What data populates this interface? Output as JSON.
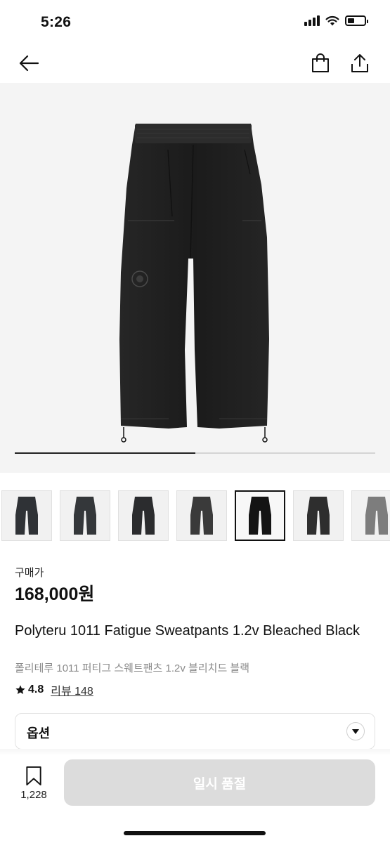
{
  "status_bar": {
    "time": "5:26"
  },
  "nav": {
    "back_icon": "arrow-left-icon",
    "bag_icon": "shopping-bag-icon",
    "share_icon": "share-icon"
  },
  "gallery": {
    "progress_fraction": 0.5,
    "thumbnail_count": 7,
    "selected_index": 4
  },
  "product": {
    "price_label": "구매가",
    "price": "168,000원",
    "title_en": "Polyteru 1011 Fatigue Sweatpants 1.2v Bleached Black",
    "title_ko": "폴리테루 1011 퍼티그 스웨트팬츠 1.2v 블리치드 블랙",
    "rating": "4.8",
    "review_text": "리뷰 148"
  },
  "option": {
    "label": "옵션"
  },
  "bottom_bar": {
    "bookmark_count": "1,228",
    "buy_label": "일시 품절",
    "buy_disabled": true
  },
  "colors": {
    "accent": "#111111",
    "disabled": "#dcdcdc",
    "hero_bg": "#f4f4f4"
  }
}
